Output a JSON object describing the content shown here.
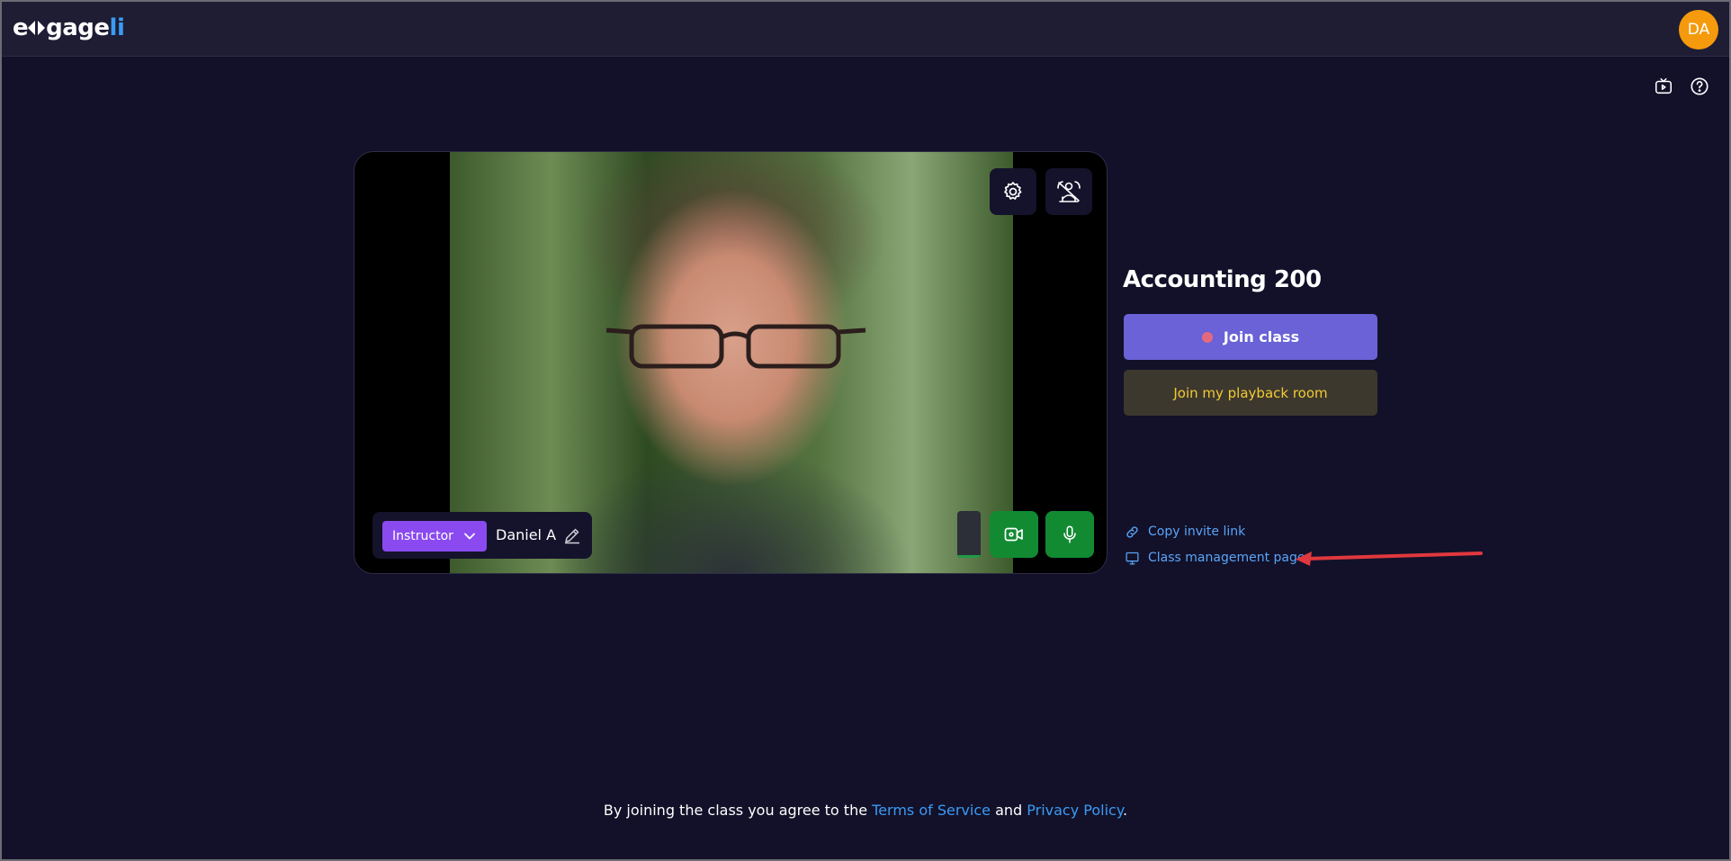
{
  "app": {
    "logo": {
      "part1": "e",
      "part2": "gage",
      "part3": "li"
    },
    "user_initials": "DA",
    "colors": {
      "background": "#121129",
      "topbar": "#1e1d34",
      "avatar": "#f59a0c",
      "join_button": "#6a62d6",
      "playback_button": "#3d382e",
      "playback_text": "#f2cb34",
      "link": "#5ba4f7",
      "role_badge": "#8a4af0",
      "media_on": "#118a32"
    }
  },
  "toolbar_icons": {
    "recordings": "playback-camera-icon",
    "help": "help-icon"
  },
  "video": {
    "settings_icon": "gear-icon",
    "layout_icon": "presenter-icon",
    "role": "Instructor",
    "name": "Daniel A",
    "edit_icon": "pencil-icon",
    "audio_level": 0.05,
    "camera_icon": "video-camera-icon",
    "mic_icon": "microphone-icon"
  },
  "class_panel": {
    "title": "Accounting 200",
    "join_label": "Join class",
    "playback_label": "Join my playback room",
    "copy_invite": "Copy invite link",
    "management_page": "Class management page"
  },
  "footer": {
    "prefix": "By joining the class you agree to the ",
    "terms": "Terms of Service",
    "middle": " and ",
    "privacy": "Privacy Policy",
    "suffix": "."
  }
}
